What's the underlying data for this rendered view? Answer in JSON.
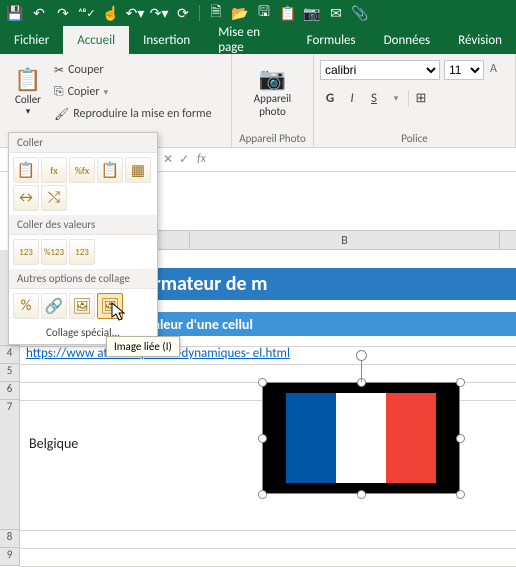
{
  "qat_icons": [
    "save",
    "undo",
    "redo",
    "spellcheck",
    "touch",
    "undo-menu",
    "redo-menu",
    "refresh",
    "sep",
    "new",
    "open",
    "print",
    "copy",
    "camera",
    "mail",
    "send"
  ],
  "tabs": [
    "Fichier",
    "Accueil",
    "Insertion",
    "Mise en page",
    "Formules",
    "Données",
    "Révision"
  ],
  "active_tab": "Accueil",
  "clipboard": {
    "paste": "Coller",
    "cut": "Couper",
    "copy": "Copier",
    "format_painter": "Reproduire la mise en forme"
  },
  "camera_group": {
    "label1": "Appareil",
    "label2": "photo",
    "footer": "Appareil Photo"
  },
  "font": {
    "name": "calibri",
    "size": "11",
    "footer": "Police",
    "b": "G",
    "i": "I",
    "u": "S"
  },
  "fx": {
    "x": "✕",
    "check": "✓",
    "fx": "fx"
  },
  "paste_menu": {
    "title1": "Coller",
    "title2": "Coller des valeurs",
    "title3": "Autres options de collage",
    "special": "Collage spécial..."
  },
  "tooltip": "Image liée (I)",
  "columns": {
    "A_width": 170,
    "B": "B"
  },
  "rows": {
    "r4": "4",
    "r5": "5",
    "r6": "6",
    "r7": "7",
    "r8": "8",
    "r9": "9"
  },
  "banner1": "tion.fr - Votre formateur de m",
  "banner2": "er une image selon la valeur d'une cellul",
  "link": "https://www                    ation.fr/photos-dynamiques-      el.html",
  "cell_text": "Belgique",
  "chart_data": null
}
